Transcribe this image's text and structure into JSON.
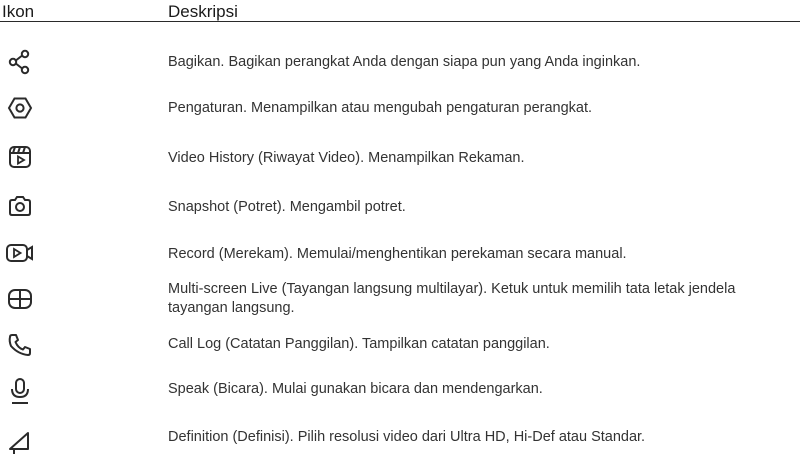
{
  "header": {
    "icon_col": "Ikon",
    "desc_col": "Deskripsi"
  },
  "rows": [
    {
      "icon": "share-icon",
      "text": "Bagikan. Bagikan perangkat Anda dengan siapa pun yang Anda inginkan."
    },
    {
      "icon": "settings-icon",
      "text": "Pengaturan. Menampilkan atau mengubah pengaturan perangkat."
    },
    {
      "icon": "video-history-icon",
      "text": "Video History (Riwayat Video). Menampilkan Rekaman."
    },
    {
      "icon": "camera-icon",
      "text": "Snapshot (Potret). Mengambil potret."
    },
    {
      "icon": "record-icon",
      "text": "Record (Merekam). Memulai/menghentikan perekaman secara manual."
    },
    {
      "icon": "multi-screen-icon",
      "text": "Multi-screen Live (Tayangan langsung multilayar). Ketuk untuk memilih tata letak jendela tayangan langsung."
    },
    {
      "icon": "phone-icon",
      "text": "Call Log (Catatan Panggilan). Tampilkan catatan panggilan."
    },
    {
      "icon": "microphone-icon",
      "text": "Speak (Bicara). Mulai gunakan bicara dan mendengarkan."
    },
    {
      "icon": "signal-icon",
      "text": "Definition (Definisi). Pilih resolusi video dari Ultra HD, Hi-Def atau Standar."
    }
  ]
}
